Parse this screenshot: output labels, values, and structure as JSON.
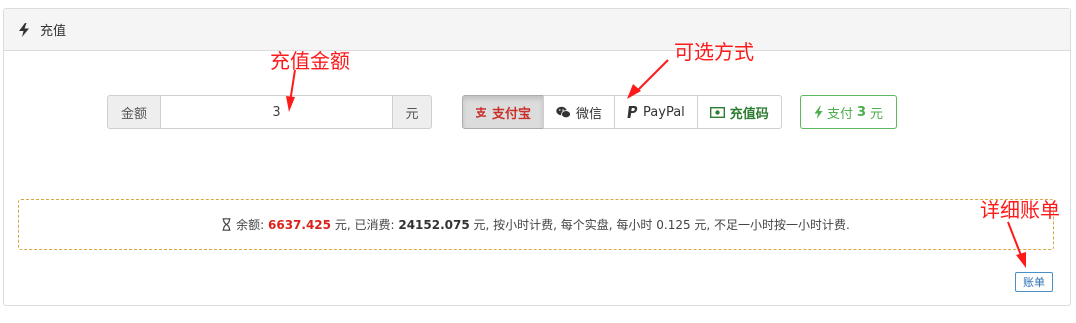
{
  "panel": {
    "title": "充值",
    "icon": "bolt-icon"
  },
  "amount_group": {
    "prefix_label": "金额",
    "value": "3",
    "suffix_label": "元"
  },
  "payment_methods": [
    {
      "label": "支付宝",
      "icon": "alipay-icon",
      "active": true
    },
    {
      "label": "微信",
      "icon": "wechat-icon",
      "active": false
    },
    {
      "label": "PayPal",
      "icon": "paypal-icon",
      "active": false
    },
    {
      "label": "充值码",
      "icon": "money-icon",
      "active": false
    }
  ],
  "pay_button": {
    "prefix": "支付",
    "amount": "3",
    "suffix": "元"
  },
  "info": {
    "balance_label": "余额:",
    "balance_value": "6637.425",
    "balance_unit": "元, 已消费:",
    "spent_value": "24152.075",
    "spent_unit": "元, 按小时计费, 每个实盘, 每小时 0.125 元, 不足一小时按一小时计费."
  },
  "bill_button": {
    "label": "账单"
  },
  "annotations": {
    "amount_note": "充值金额",
    "methods_note": "可选方式",
    "bill_note": "详细账单"
  },
  "colors": {
    "annotation": "#ff1a1a",
    "balance": "#d9231c",
    "pay_green": "#5cb85c",
    "dashed_border": "#d9a441"
  }
}
